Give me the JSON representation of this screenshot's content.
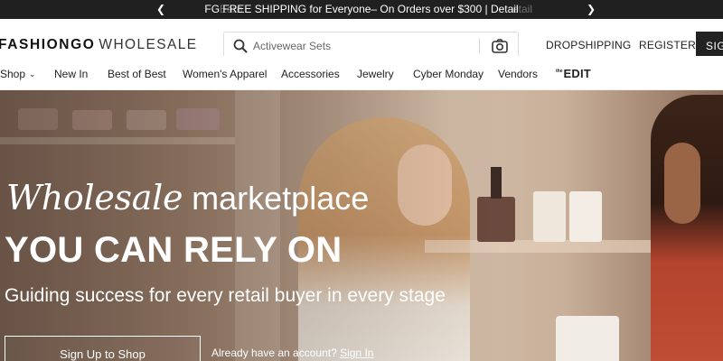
{
  "announcement": {
    "ghost_left": "Earn",
    "message": "FG FREE SHIPPING for Everyone– On Orders over $300 | Detail",
    "ghost_right": "etail",
    "prev_icon": "chevron-left-icon",
    "next_icon": "chevron-right-icon"
  },
  "header": {
    "logo_brand": "FASHIONGO",
    "logo_sub": "WHOLESALE",
    "search": {
      "placeholder": "Activewear Sets",
      "icon": "search-icon",
      "camera_icon": "camera-icon"
    },
    "links": {
      "dropshipping": "DROPSHIPPING",
      "register": "REGISTER",
      "sign_in": "SIGN IN"
    }
  },
  "nav": {
    "items": [
      {
        "label": "Shop"
      },
      {
        "label": "New In"
      },
      {
        "label": "Best of Best"
      },
      {
        "label": "Women's Apparel"
      },
      {
        "label": "Accessories"
      },
      {
        "label": "Jewelry"
      },
      {
        "label": "Cyber Monday"
      },
      {
        "label": "Vendors"
      }
    ],
    "edit_the": "the",
    "edit_label": "EDIT"
  },
  "hero": {
    "line1_italic": "Wholesale",
    "line1_regular": " marketplace",
    "line2": "YOU CAN RELY ON",
    "line3": "Guiding success for every retail buyer in every stage",
    "cta": "Sign Up to Shop",
    "already_text": "Already have an account? ",
    "sign_in_link": "Sign In"
  },
  "colors": {
    "topbar_bg": "#202020",
    "header_bg": "#ffffff",
    "signin_bg": "#222222",
    "hero_text": "#ffffff"
  }
}
